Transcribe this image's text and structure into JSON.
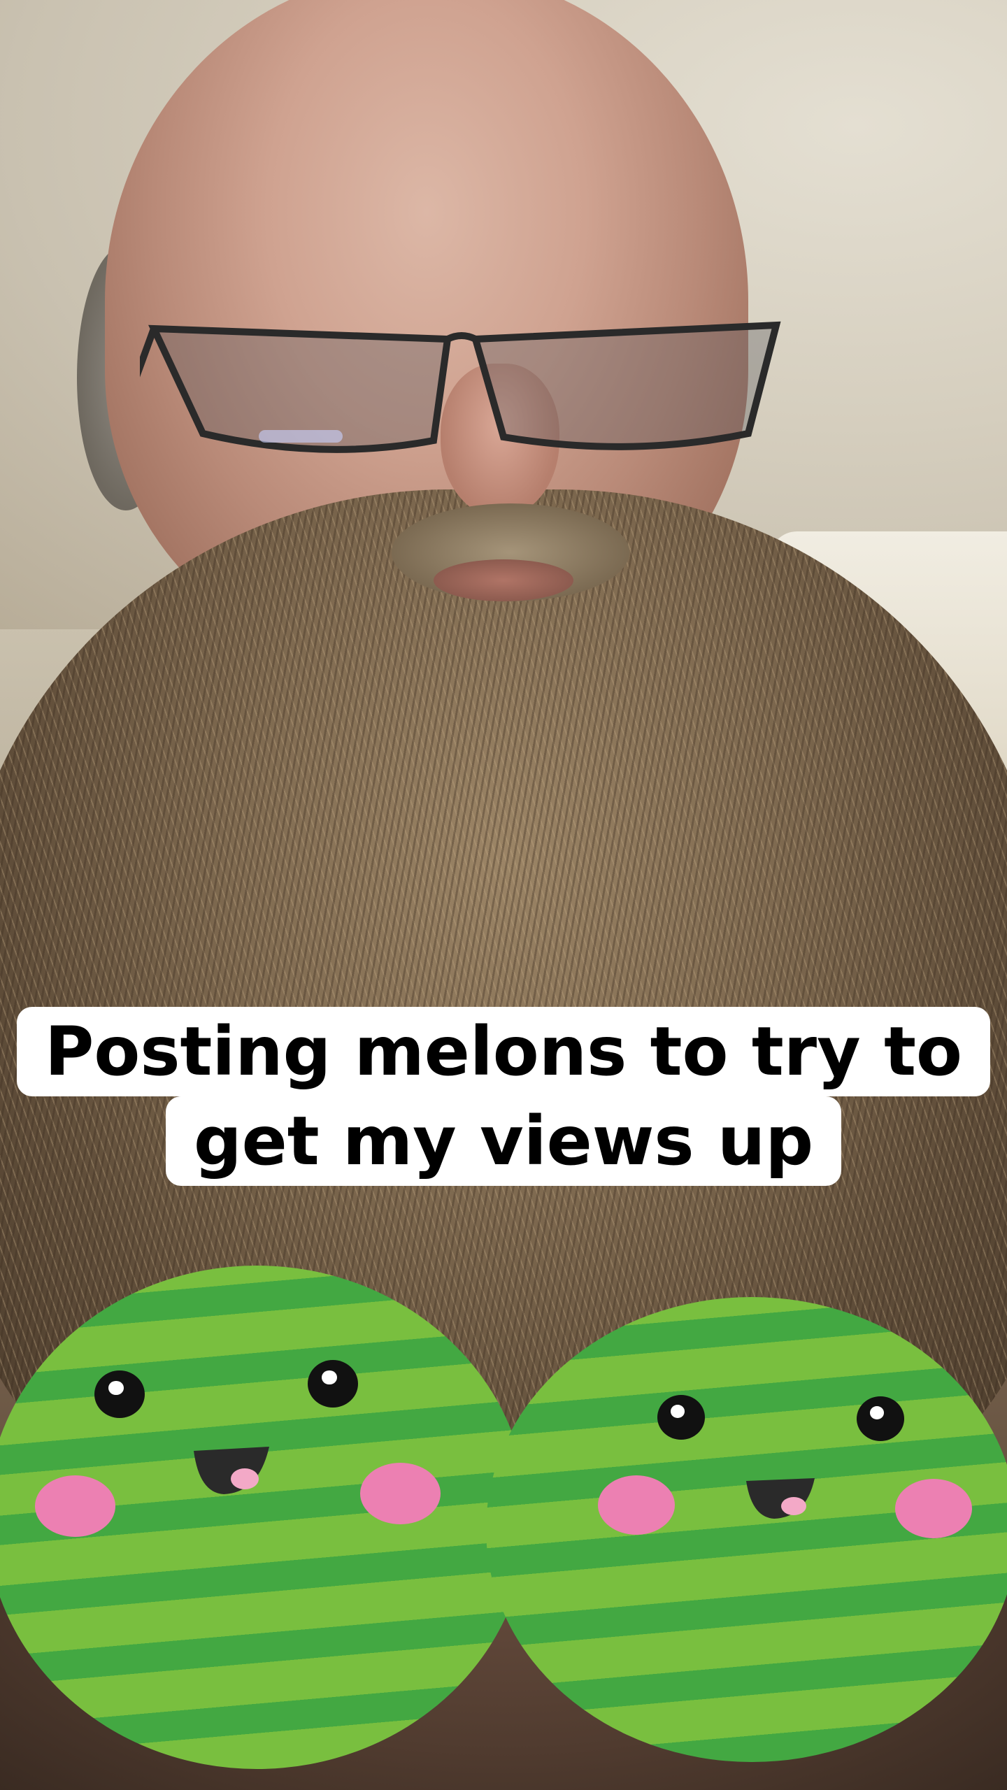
{
  "caption": {
    "line1": "Posting melons to try to",
    "line2": "get my views up"
  },
  "stickers": {
    "left": "watermelon-face",
    "right": "watermelon-face"
  },
  "colors": {
    "melon_light": "#79bf3f",
    "melon_dark": "#43a842",
    "cheek": "#ec80b2",
    "caption_bg": "#ffffff",
    "caption_text": "#000000"
  }
}
